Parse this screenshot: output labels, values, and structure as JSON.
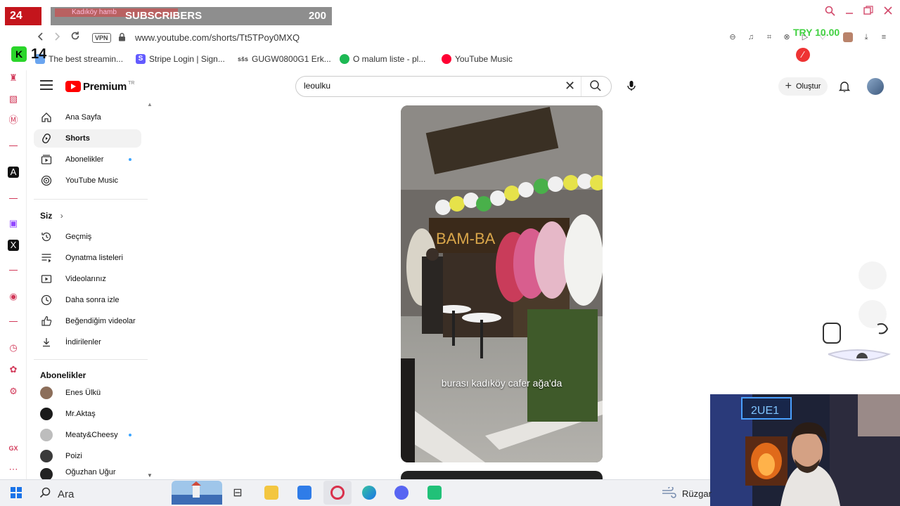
{
  "overlay": {
    "live_badge": "24",
    "subscribers_tab": "Kadıköy hamb",
    "subscribers_label": "SUBSCRIBERS",
    "subscribers_count": "200",
    "counter_badge": "14",
    "try_value": "TRY 10.00"
  },
  "browser": {
    "vpn_label": "VPN",
    "url": "www.youtube.com/shorts/Tt5TPoy0MXQ"
  },
  "bookmarks": [
    {
      "label": "The best streamin...",
      "color": "#6aa5f0"
    },
    {
      "label": "Stripe Login | Sign...",
      "color": "#635bff"
    },
    {
      "label": "GUGW0800G1 Erk...",
      "color": "#444444"
    },
    {
      "label": "O malum liste - pl...",
      "color": "#1db954"
    },
    {
      "label": "YouTube Music",
      "color": "#ff0033"
    }
  ],
  "youtube": {
    "logo_text": "Premium",
    "logo_region": "TR",
    "search_value": "leoulku",
    "create_label": "Oluştur"
  },
  "sidebar": {
    "main": [
      {
        "label": "Ana Sayfa",
        "icon": "home-icon"
      },
      {
        "label": "Shorts",
        "icon": "shorts-icon"
      },
      {
        "label": "Abonelikler",
        "icon": "subscriptions-icon"
      },
      {
        "label": "YouTube Music",
        "icon": "youtube-music-icon"
      }
    ],
    "you_heading": "Siz",
    "you": [
      {
        "label": "Geçmiş",
        "icon": "history-icon"
      },
      {
        "label": "Oynatma listeleri",
        "icon": "playlists-icon"
      },
      {
        "label": "Videolarınız",
        "icon": "your-videos-icon"
      },
      {
        "label": "Daha sonra izle",
        "icon": "watch-later-icon"
      },
      {
        "label": "Beğendiğim videolar",
        "icon": "liked-icon"
      },
      {
        "label": "İndirilenler",
        "icon": "downloads-icon"
      }
    ],
    "subs_heading": "Abonelikler",
    "subs": [
      {
        "label": "Enes Ülkü",
        "color": "#8c6e5a"
      },
      {
        "label": "Mr.Aktaş",
        "color": "#1a1a1a"
      },
      {
        "label": "Meaty&Cheesy",
        "color": "#bdbdbd"
      },
      {
        "label": "Poizi",
        "color": "#3a3a3a"
      },
      {
        "label": "Oğuzhan Uğur",
        "color": "#222222"
      }
    ]
  },
  "short": {
    "caption": "burası kadıköy cafer ağa'da"
  },
  "taskbar": {
    "search_label": "Ara",
    "weather_label": "Rüzgar"
  }
}
